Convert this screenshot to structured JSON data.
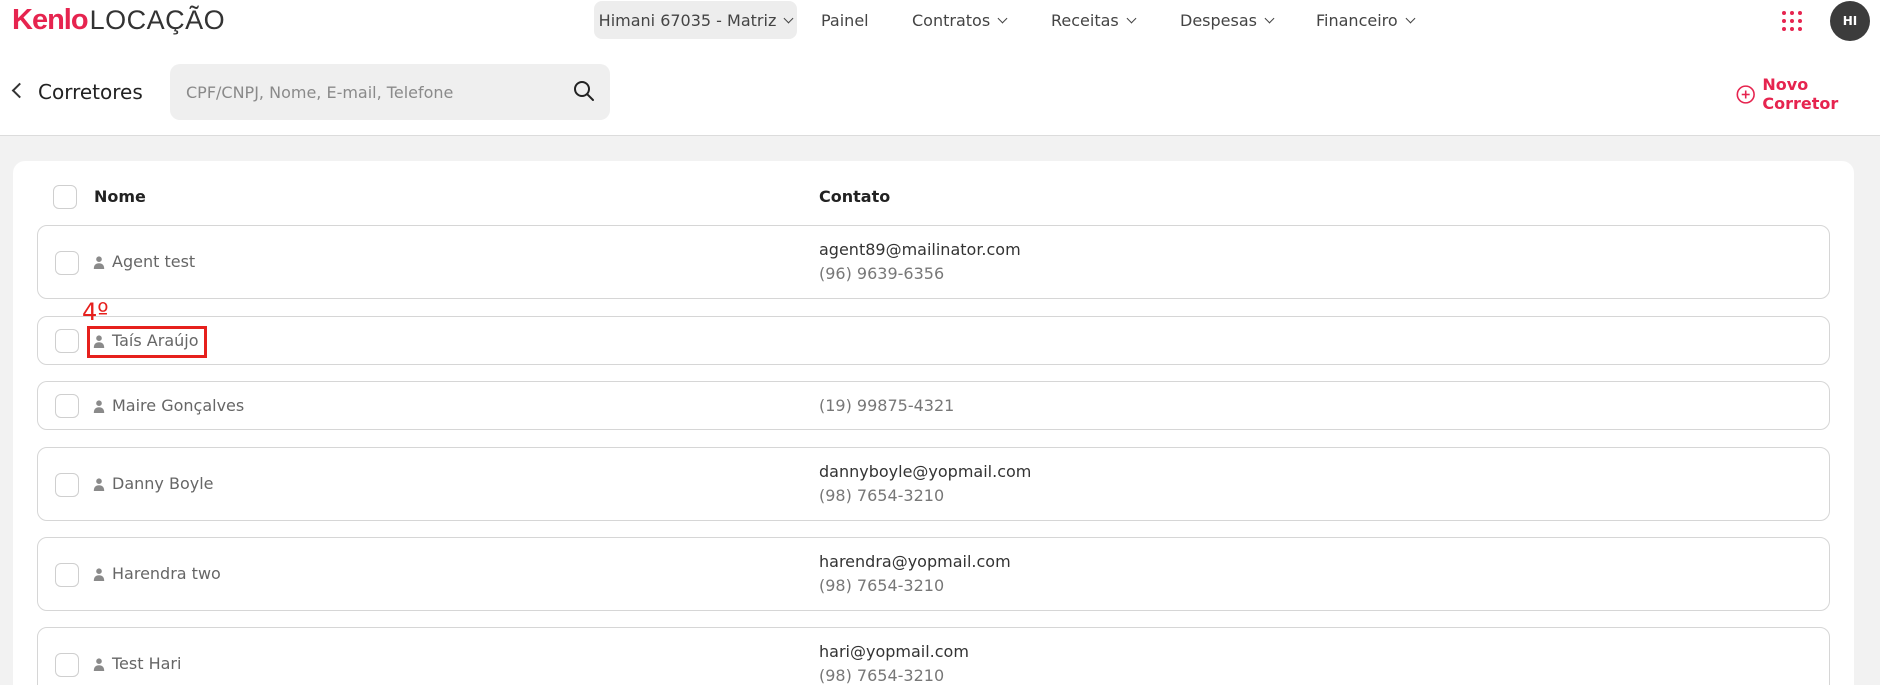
{
  "nav": {
    "brand": "Kenlo",
    "product": "LOCAÇÃO",
    "branch": "Himani 67035 - Matriz",
    "menu": {
      "painel": "Painel",
      "contratos": "Contratos",
      "receitas": "Receitas",
      "despesas": "Despesas",
      "financeiro": "Financeiro"
    },
    "avatar_initials": "HI",
    "accent_color": "#e6244f"
  },
  "header": {
    "title": "Corretores",
    "search_placeholder": "CPF/CNPJ, Nome, E-mail, Telefone",
    "search_value": "",
    "new_button": "Novo Corretor"
  },
  "table": {
    "columns": {
      "name": "Nome",
      "contact": "Contato"
    },
    "rows": [
      {
        "name": "Agent test",
        "email": "agent89@mailinator.com",
        "phone": "(96) 9639-6356"
      },
      {
        "name": "Taís Araújo",
        "email": "",
        "phone": ""
      },
      {
        "name": "Maire Gonçalves",
        "email": "",
        "phone": "(19) 99875-4321"
      },
      {
        "name": "Danny Boyle",
        "email": "dannyboyle@yopmail.com",
        "phone": "(98) 7654-3210"
      },
      {
        "name": "Harendra two",
        "email": "harendra@yopmail.com",
        "phone": "(98) 7654-3210"
      },
      {
        "name": "Test Hari",
        "email": "hari@yopmail.com",
        "phone": "(98) 7654-3210"
      }
    ]
  },
  "annotation": {
    "label": "4º",
    "color": "#e6201d"
  }
}
